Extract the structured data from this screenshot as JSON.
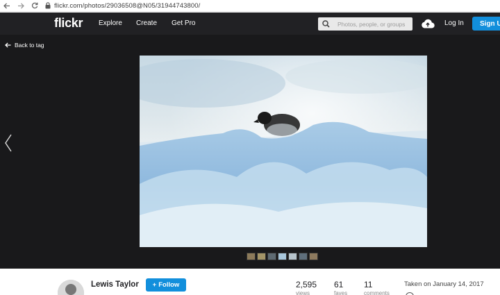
{
  "browser": {
    "url": "flickr.com/photos/29036508@N05/31944743800/",
    "icons": [
      "back-arrow-icon",
      "forward-arrow-icon",
      "reload-icon",
      "lock-icon"
    ]
  },
  "header": {
    "logo": "flickr",
    "nav": [
      "Explore",
      "Create",
      "Get Pro"
    ],
    "search_placeholder": "Photos, people, or groups",
    "login": "Log In",
    "signup": "Sign Up",
    "accent": "#128fdc"
  },
  "stage": {
    "back_label": "Back to tag",
    "thumbnail_count": 7
  },
  "info": {
    "author": "Lewis Taylor",
    "follow": "Follow",
    "stats": [
      {
        "value": "2,595",
        "label": "views"
      },
      {
        "value": "61",
        "label": "faves"
      },
      {
        "value": "11",
        "label": "comments"
      }
    ],
    "taken": "Taken on January 14, 2017"
  }
}
